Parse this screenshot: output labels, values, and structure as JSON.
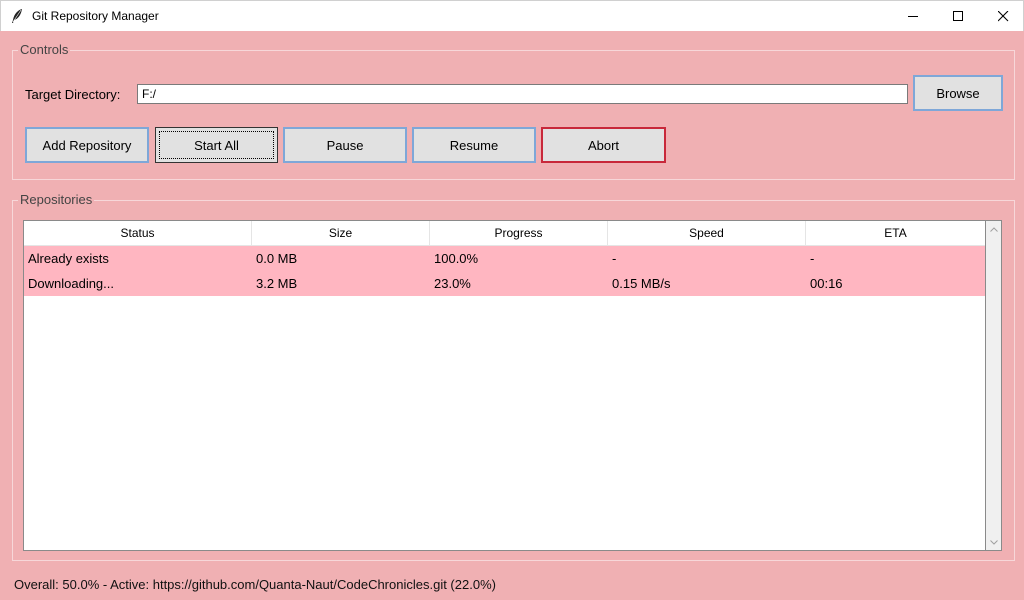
{
  "window": {
    "title": "Git Repository Manager",
    "icon": "feather-icon"
  },
  "controls": {
    "group_label": "Controls",
    "target_label": "Target Directory:",
    "target_value": "F:/",
    "browse_label": "Browse",
    "add_label": "Add Repository",
    "start_label": "Start All",
    "pause_label": "Pause",
    "resume_label": "Resume",
    "abort_label": "Abort"
  },
  "repositories": {
    "group_label": "Repositories",
    "columns": [
      "Status",
      "Size",
      "Progress",
      "Speed",
      "ETA"
    ],
    "rows": [
      [
        "Already exists",
        "0.0 MB",
        "100.0%",
        "-",
        "-"
      ],
      [
        "Downloading...",
        "3.2 MB",
        "23.0%",
        "0.15 MB/s",
        "00:16"
      ]
    ]
  },
  "status": {
    "text": "Overall: 50.0% - Active: https://github.com/Quanta-Naut/CodeChronicles.git (22.0%)"
  },
  "colors": {
    "background": "#f0b0b3",
    "row_highlight": "#ffb6c1",
    "abort_border": "#c8283a",
    "button_border": "#7ea7d8"
  }
}
